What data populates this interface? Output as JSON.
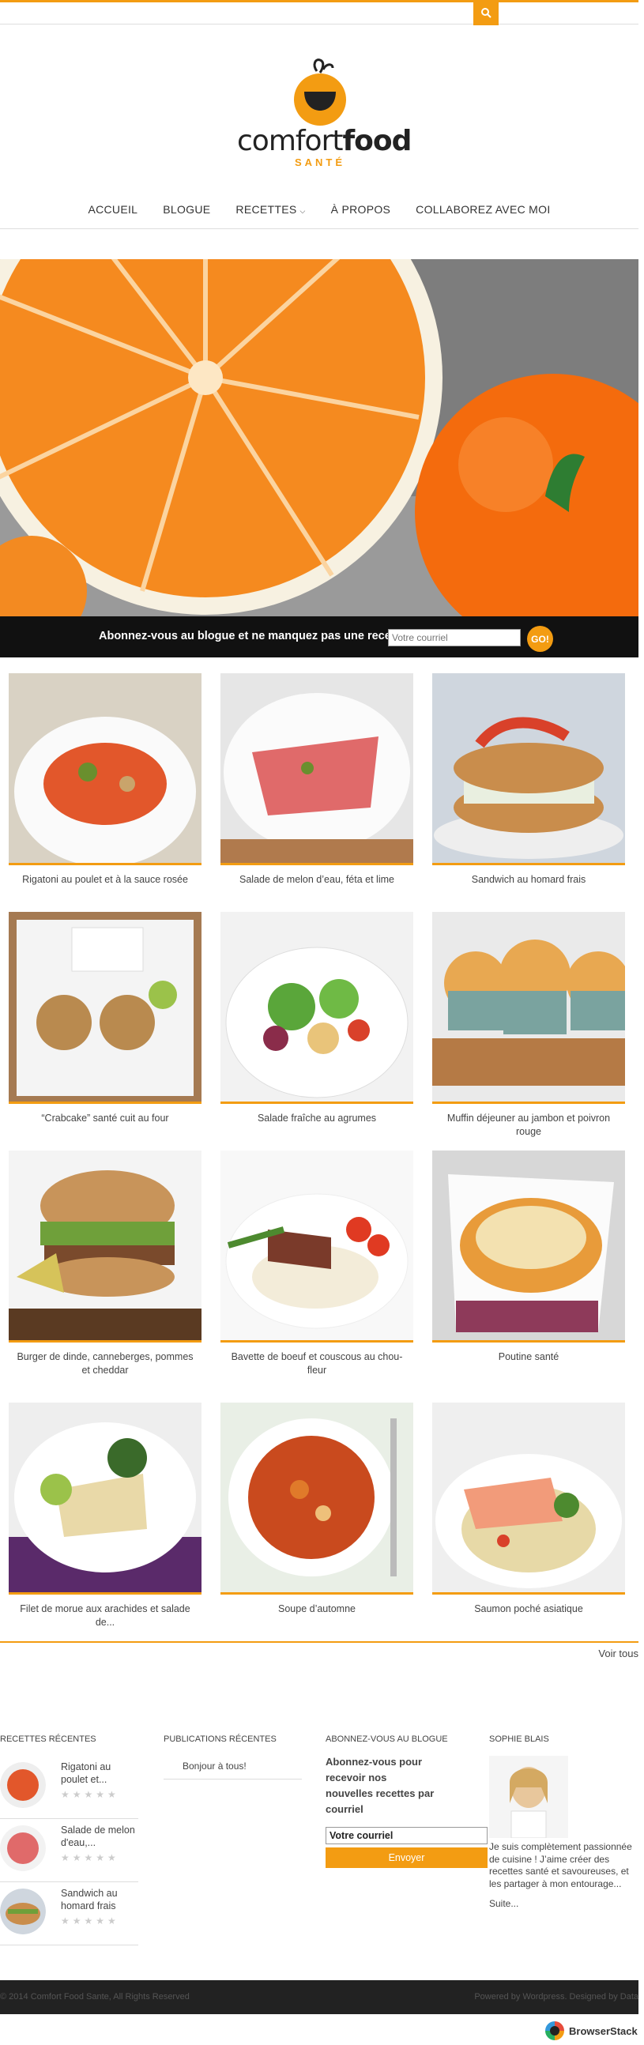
{
  "header": {
    "search_icon": "search-icon",
    "logo_word_light": "comfort",
    "logo_word_bold": "food",
    "logo_sub": "SANTÉ"
  },
  "nav": {
    "items": [
      {
        "label": "ACCUEIL"
      },
      {
        "label": "BLOGUE"
      },
      {
        "label": "RECETTES",
        "has_caret": true
      },
      {
        "label": "À PROPOS"
      },
      {
        "label": "COLLABOREZ AVEC MOI"
      }
    ]
  },
  "subscribe_bar": {
    "message": "Abonnez-vous au blogue et ne manquez pas une recette!",
    "placeholder": "Votre courriel",
    "button": "GO!"
  },
  "recipes": [
    {
      "title": "Rigatoni au poulet et à la sauce rosée"
    },
    {
      "title": "Salade de melon d’eau, féta et lime"
    },
    {
      "title": "Sandwich au homard frais"
    },
    {
      "title": "“Crabcake” santé cuit au four"
    },
    {
      "title": "Salade fraîche au agrumes"
    },
    {
      "title": "Muffin déjeuner au jambon et poivron rouge"
    },
    {
      "title": "Burger de dinde, canneberges, pommes et cheddar"
    },
    {
      "title": "Bavette de boeuf et couscous au chou-fleur"
    },
    {
      "title": "Poutine santé"
    },
    {
      "title": "Filet de morue aux arachides et salade de..."
    },
    {
      "title": "Soupe d’automne"
    },
    {
      "title": "Saumon poché asiatique"
    }
  ],
  "voir_tous": "Voir tous",
  "footer_widgets": {
    "recent_recipes": {
      "heading": "RECETTES RÉCENTES",
      "items": [
        {
          "title": "Rigatoni au poulet et..."
        },
        {
          "title": "Salade de melon d'eau,..."
        },
        {
          "title": "Sandwich au homard frais"
        }
      ]
    },
    "publications": {
      "heading": "PUBLICATIONS RÉCENTES",
      "items": [
        {
          "title": "Bonjour à tous!"
        }
      ]
    },
    "subscribe": {
      "heading": "ABONNEZ-VOUS AU BLOGUE",
      "text": "Abonnez-vous pour recevoir nos nouvelles recettes par courriel",
      "input_value": "Votre courriel",
      "button": "Envoyer"
    },
    "author": {
      "heading": "SOPHIE BLAIS",
      "bio": "Je suis complètement passionnée de cuisine ! J’aime créer des recettes santé et savoureuses, et les partager à mon entourage...",
      "more": "Suite..."
    }
  },
  "footer": {
    "copyright": "© 2014 Comfort Food Sante, All Rights Reserved",
    "credits": "Powered by Wordpress. Designed by Data"
  },
  "browserstack": "BrowserStack",
  "colors": {
    "accent": "#f39c12",
    "dark": "#111111"
  }
}
